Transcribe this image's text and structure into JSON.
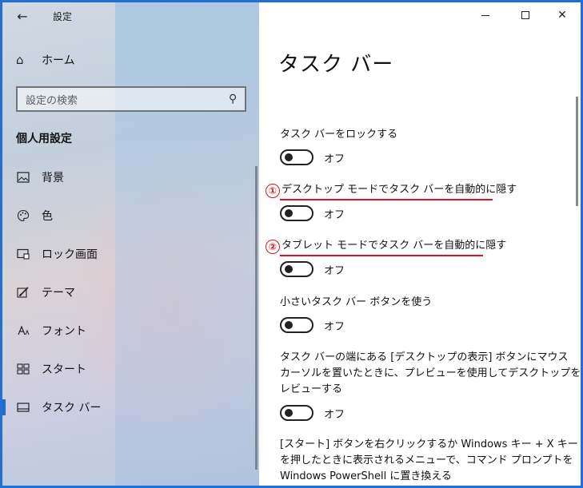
{
  "window": {
    "title": "設定",
    "back_icon": "←",
    "controls": {
      "minimize": "minimize-icon",
      "maximize": "maximize-icon",
      "close": "✕"
    }
  },
  "sidebar": {
    "home_icon": "⌂",
    "home_label": "ホーム",
    "search_placeholder": "設定の検索",
    "search_icon": "⚲",
    "section_title": "個人用設定",
    "items": [
      {
        "icon": "🖾",
        "label": "背景"
      },
      {
        "icon": "☺",
        "label": "色"
      },
      {
        "icon": "▭",
        "label": "ロック画面"
      },
      {
        "icon": "✎",
        "label": "テーマ"
      },
      {
        "icon": "A",
        "label": "フォント"
      },
      {
        "icon": "▦",
        "label": "スタート"
      },
      {
        "icon": "▬",
        "label": "タスク バー"
      }
    ],
    "active_index": 6
  },
  "main": {
    "title": "タスク バー",
    "settings": [
      {
        "label": "タスク バーをロックする",
        "state": "オフ"
      },
      {
        "marker": "①",
        "label": "デスクトップ モードでタスク バーを自動的に隠す",
        "state": "オフ"
      },
      {
        "marker": "②",
        "label": "タブレット モードでタスク バーを自動的に隠す",
        "state": "オフ"
      },
      {
        "label": "小さいタスク バー ボタンを使う",
        "state": "オフ"
      },
      {
        "label_lines": [
          "タスク バーの端にある [デスクトップの表示] ボタンにマウス",
          "カーソルを置いたときに、プレビューを使用してデスクトップをプ",
          "レビューする"
        ],
        "state": "オフ"
      },
      {
        "label_lines": [
          "[スタート] ボタンを右クリックするか Windows キー + X キー",
          "を押したときに表示されるメニューで、コマンド プロンプトを",
          "Windows PowerShell に置き換える"
        ]
      }
    ]
  },
  "colors": {
    "accent": "#1a6fc9",
    "annotation": "#e0141e",
    "frame": "#1f6fd6"
  }
}
